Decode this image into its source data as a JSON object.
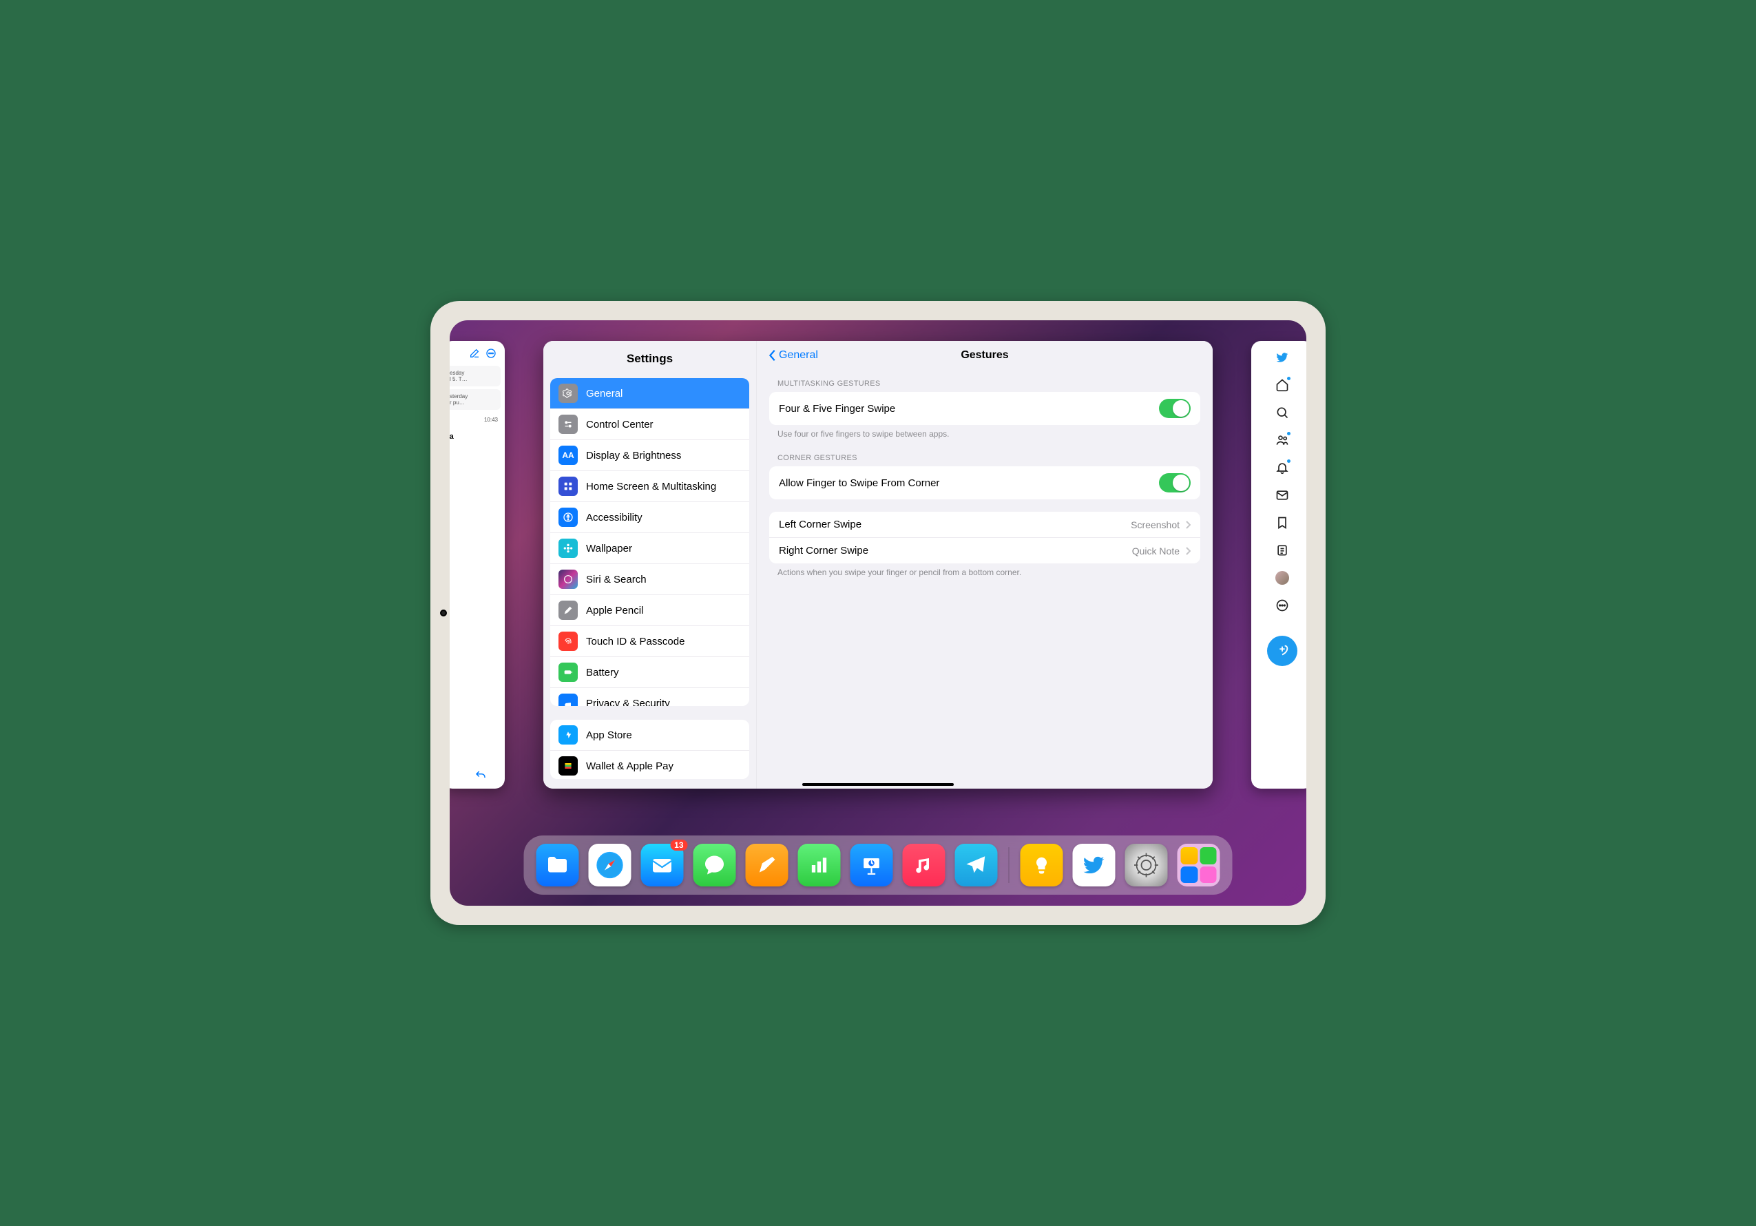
{
  "sidebar": {
    "title": "Settings",
    "groups": [
      [
        {
          "label": "General",
          "icon": "gear-icon",
          "bg": "#8e8e93",
          "selected": true
        },
        {
          "label": "Control Center",
          "icon": "switches-icon",
          "bg": "#8e8e93"
        },
        {
          "label": "Display & Brightness",
          "icon": "aa-icon",
          "bg": "#0a7aff"
        },
        {
          "label": "Home Screen & Multitasking",
          "icon": "grid-icon",
          "bg": "#3450d6"
        },
        {
          "label": "Accessibility",
          "icon": "accessibility-icon",
          "bg": "#0a7aff"
        },
        {
          "label": "Wallpaper",
          "icon": "flower-icon",
          "bg": "#18bdd6"
        },
        {
          "label": "Siri & Search",
          "icon": "siri-icon",
          "bg": "#222"
        },
        {
          "label": "Apple Pencil",
          "icon": "pencil-icon",
          "bg": "#8e8e93"
        },
        {
          "label": "Touch ID & Passcode",
          "icon": "fingerprint-icon",
          "bg": "#ff3b30"
        },
        {
          "label": "Battery",
          "icon": "battery-icon",
          "bg": "#34c759"
        },
        {
          "label": "Privacy & Security",
          "icon": "hand-icon",
          "bg": "#0a7aff"
        }
      ],
      [
        {
          "label": "App Store",
          "icon": "appstore-icon",
          "bg": "#0aa2ff"
        },
        {
          "label": "Wallet & Apple Pay",
          "icon": "wallet-icon",
          "bg": "#000"
        }
      ]
    ]
  },
  "detail": {
    "back_label": "General",
    "title": "Gestures",
    "sections": {
      "multi_header": "MULTITASKING GESTURES",
      "multi_row": "Four & Five Finger Swipe",
      "multi_footer": "Use four or five fingers to swipe between apps.",
      "corner_header": "CORNER GESTURES",
      "corner_allow": "Allow Finger to Swipe From Corner",
      "left_label": "Left Corner Swipe",
      "left_value": "Screenshot",
      "right_label": "Right Corner Swipe",
      "right_value": "Quick Note",
      "corner_footer": "Actions when you swipe your finger or pencil from a bottom corner."
    }
  },
  "peek_left": {
    "card1_line1": "esday",
    "card1_line2": "l 5. T…",
    "card2_line1": "sterday",
    "card2_line2": "r pu…",
    "time": "10:43",
    "bold_text": "ta"
  },
  "dock": {
    "mail_badge": "13",
    "apps": [
      "files",
      "safari",
      "mail",
      "messages",
      "pages",
      "numbers",
      "keynote",
      "music",
      "telegram"
    ],
    "recent": [
      "tips",
      "twitter",
      "settings"
    ]
  }
}
